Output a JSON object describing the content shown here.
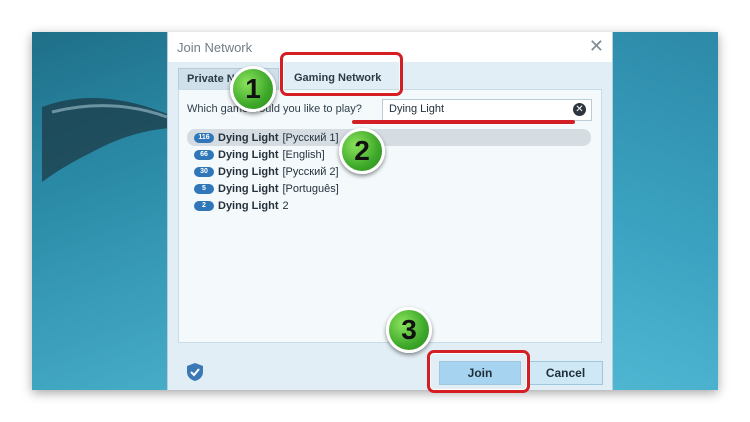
{
  "window": {
    "title": "Join Network"
  },
  "tabs": [
    {
      "label": "Private Network"
    },
    {
      "label": "Gaming Network"
    }
  ],
  "search": {
    "label": "Which game would you like to play?",
    "value": "Dying Light"
  },
  "games": [
    {
      "count": "116",
      "name": "Dying Light",
      "variant": "[Русский 1]"
    },
    {
      "count": "66",
      "name": "Dying Light",
      "variant": "[English]"
    },
    {
      "count": "30",
      "name": "Dying Light",
      "variant": "[Русский 2]"
    },
    {
      "count": "5",
      "name": "Dying Light",
      "variant": "[Português]"
    },
    {
      "count": "2",
      "name": "Dying Light",
      "variant": "2"
    }
  ],
  "buttons": {
    "join": "Join",
    "cancel": "Cancel"
  },
  "steps": [
    "1",
    "2",
    "3"
  ],
  "colors": {
    "highlight": "#d41e24",
    "badge": "#2f77b8",
    "step_ball": "#3ea82a"
  }
}
